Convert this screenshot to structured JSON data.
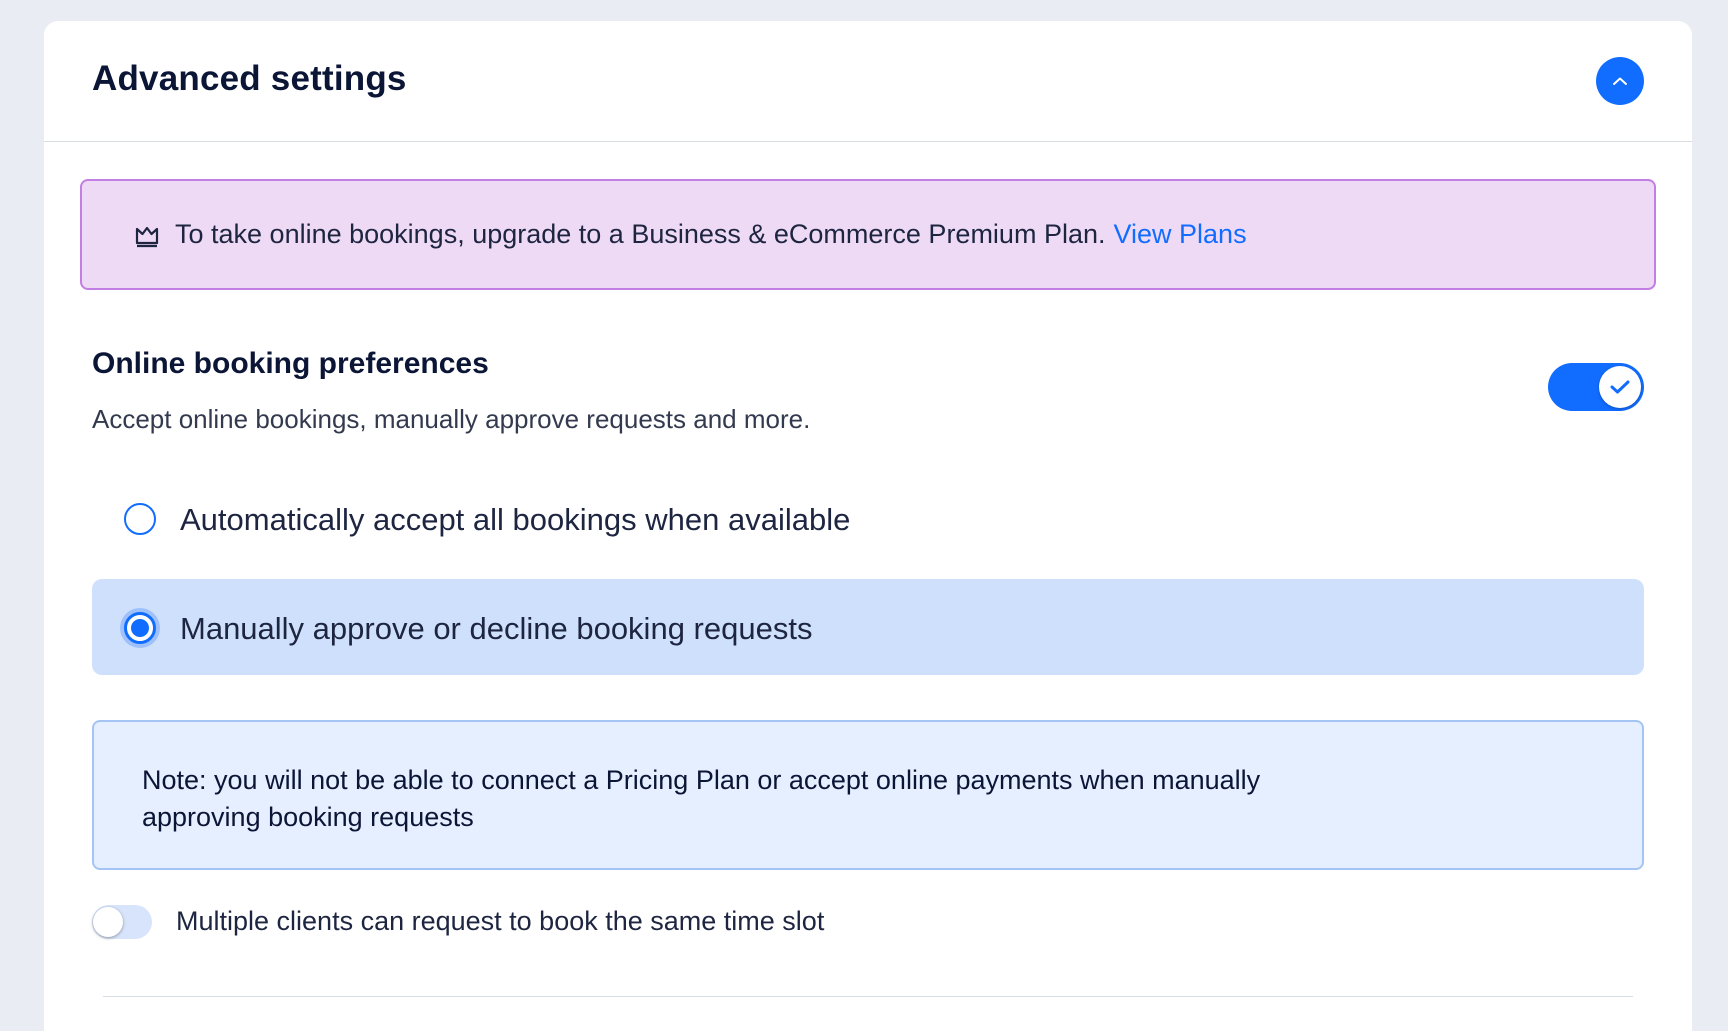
{
  "header": {
    "title": "Advanced settings",
    "collapse_icon": "chevron-up-icon"
  },
  "premium_banner": {
    "icon": "crown-icon",
    "text": "To take online bookings, upgrade to a Business & eCommerce Premium Plan.",
    "link_label": "View Plans"
  },
  "booking_preferences": {
    "title": "Online booking preferences",
    "description": "Accept online bookings, manually approve requests and more.",
    "enabled": true,
    "options": [
      {
        "label": "Automatically accept all bookings when available",
        "selected": false
      },
      {
        "label": "Manually approve or decline booking requests",
        "selected": true
      }
    ],
    "note": "Note: you will not be able to connect a Pricing Plan or accept online payments when manually approving booking requests",
    "multiple_clients": {
      "label": "Multiple clients can request to book the same time slot",
      "enabled": false
    }
  },
  "colors": {
    "accent": "#116dff",
    "banner_bg": "#efdaf5",
    "banner_border": "#c37ee3",
    "selected_row_bg": "#cfe0fd",
    "note_bg": "#e6efff"
  }
}
